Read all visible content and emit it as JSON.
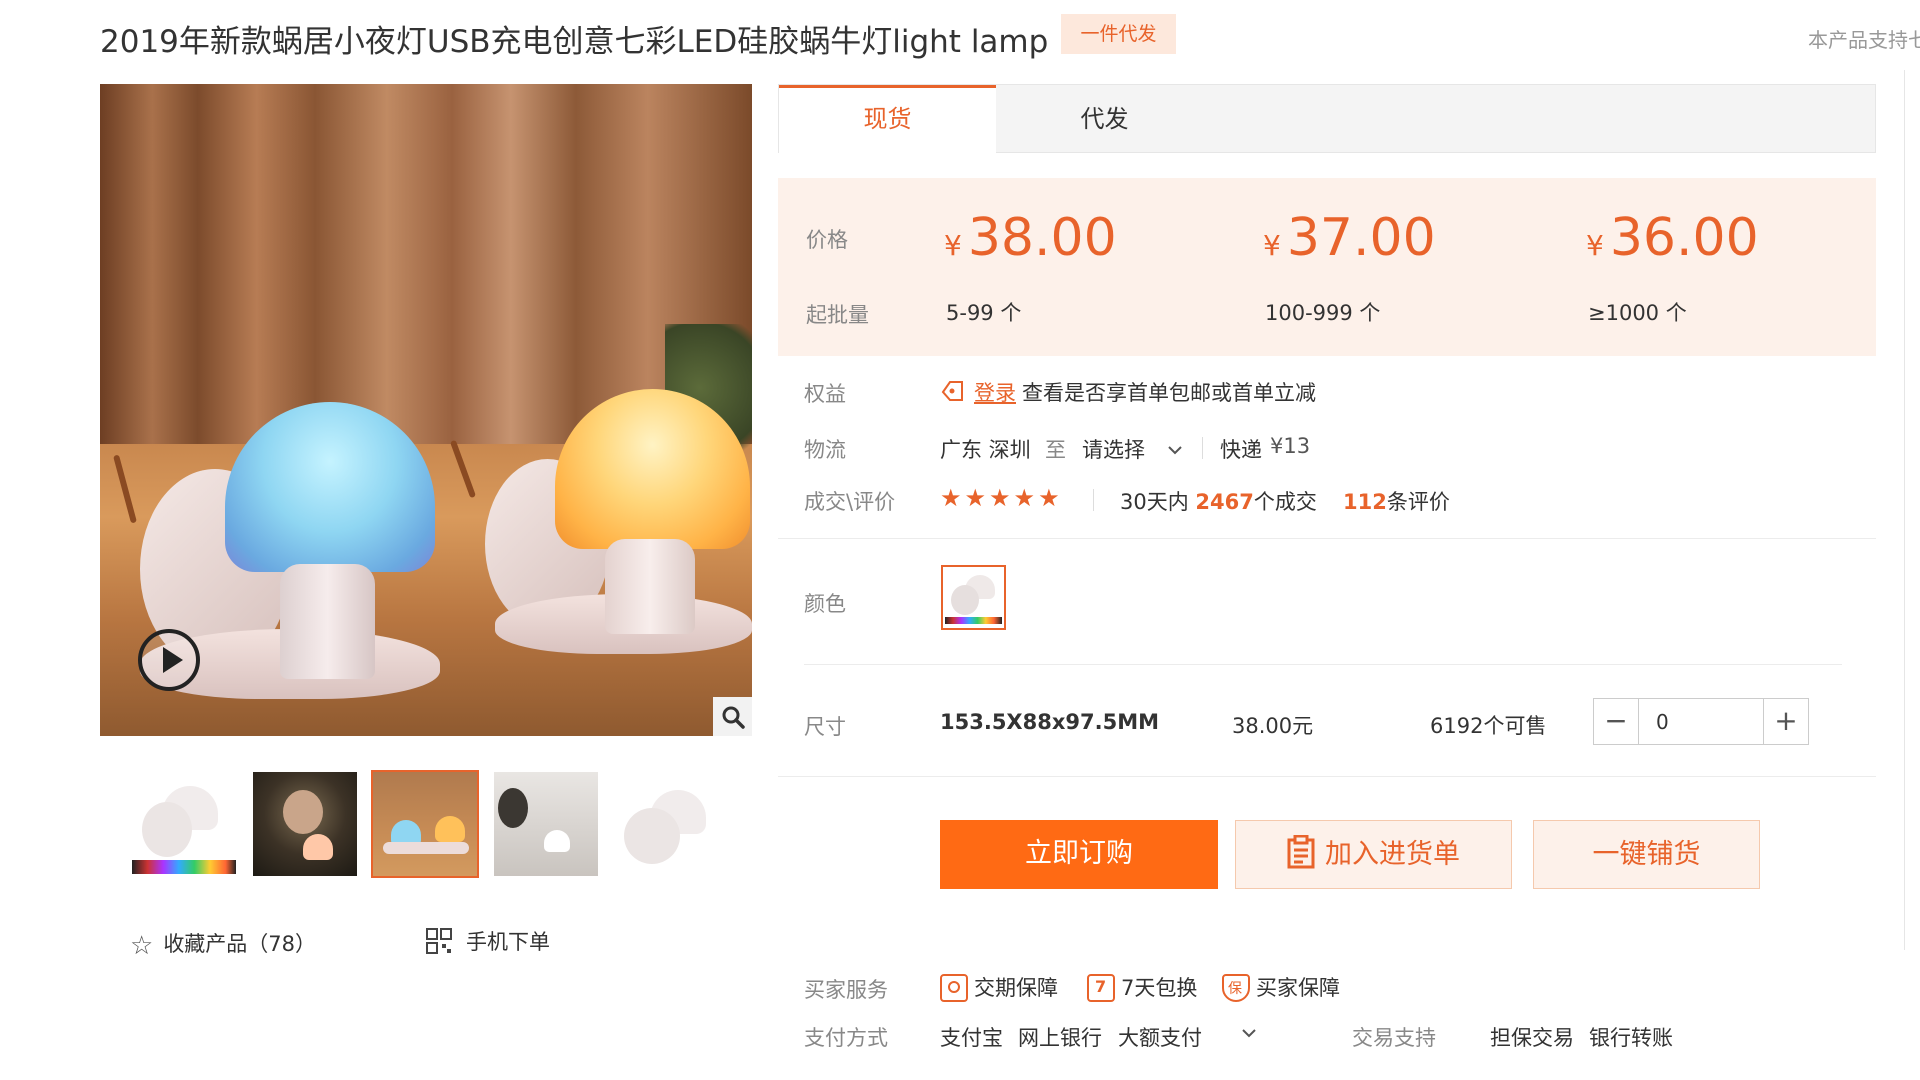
{
  "title": "2019年新款蜗居小夜灯USB充电创意七彩LED硅胶蜗牛灯light lamp",
  "title_badge": "一件代发",
  "top_right_text": "本产品支持七",
  "tabs": [
    {
      "label": "现货",
      "active": true
    },
    {
      "label": "代发",
      "active": false
    }
  ],
  "price_panel": {
    "price_label": "价格",
    "qty_label": "起批量",
    "currency": "¥",
    "tiers": [
      {
        "price": "38.00",
        "qty": "5-99 个"
      },
      {
        "price": "37.00",
        "qty": "100-999 个"
      },
      {
        "price": "36.00",
        "qty": "≥1000 个"
      }
    ]
  },
  "benefits": {
    "label": "权益",
    "login_link": "登录",
    "text": "查看是否享首单包邮或首单立减"
  },
  "logistics": {
    "label": "物流",
    "from": "广东 深圳",
    "to_word": "至",
    "dest_select": "请选择",
    "express": "快递",
    "fee": "¥13"
  },
  "reviews": {
    "label": "成交\\评价",
    "stars": "★★★★★",
    "days_prefix": "30天内",
    "deals": "2467",
    "deals_suffix": "个成交",
    "review_count": "112",
    "review_suffix": "条评价"
  },
  "color": {
    "label": "颜色"
  },
  "size": {
    "label": "尺寸",
    "value": "153.5X88x97.5MM",
    "price": "38.00元",
    "stock": "6192个可售",
    "quantity": "0"
  },
  "buttons": {
    "buy": "立即订购",
    "cart": "加入进货单",
    "distribute": "一键铺货"
  },
  "favorite": "收藏产品（78）",
  "mobile_order": "手机下单",
  "buyer_service": {
    "label": "买家服务",
    "items": [
      "交期保障",
      "7天包换",
      "买家保障"
    ]
  },
  "payment": {
    "label": "支付方式",
    "methods": [
      "支付宝",
      "网上银行",
      "大额支付"
    ],
    "trade_label": "交易支持",
    "trade_items": [
      "担保交易",
      "银行转账"
    ]
  },
  "colors": {
    "accent": "#e8632b",
    "buy_button": "#ff6a14",
    "price_panel_bg": "#fdf1ea"
  }
}
